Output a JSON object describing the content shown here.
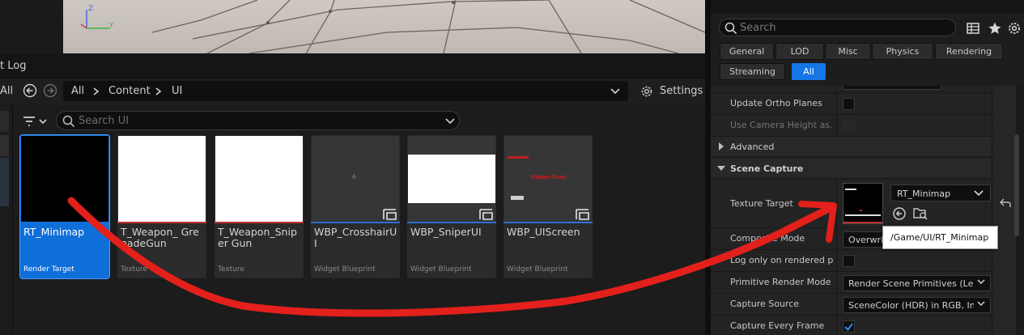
{
  "content_browser": {
    "tab_label": "t Log",
    "nav_all": "All",
    "breadcrumb": [
      "All",
      "Content",
      "UI"
    ],
    "settings_label": "Settings",
    "search_placeholder": "Search UI",
    "assets": [
      {
        "name": "RT_Minimap",
        "type": "Render Target",
        "selected": true
      },
      {
        "name": "T_Weapon_ GrenadeGun",
        "type": "Texture",
        "selected": false
      },
      {
        "name": "T_Weapon_Sniper Gun",
        "type": "Texture",
        "selected": false
      },
      {
        "name": "WBP_CrosshairUI",
        "type": "Widget Blueprint",
        "selected": false
      },
      {
        "name": "WBP_SniperUI",
        "type": "Widget Blueprint",
        "selected": false
      },
      {
        "name": "WBP_UIScreen",
        "type": "Widget Blueprint",
        "selected": false
      }
    ],
    "thumb_game_over": "Game Over",
    "thumb_crosshair": "✧"
  },
  "details": {
    "search_placeholder": "Search",
    "categories": [
      "General",
      "LOD",
      "Misc",
      "Physics",
      "Rendering",
      "Streaming",
      "All"
    ],
    "active_category": "All",
    "rows": {
      "update_ortho": "Update Ortho Planes",
      "camera_height": "Use Camera Height as...",
      "advanced": "Advanced",
      "scene_capture": "Scene Capture",
      "texture_target": "Texture Target",
      "texture_target_value": "RT_Minimap",
      "composite_mode": "Composite Mode",
      "composite_value": "Overwrite",
      "rendered_prims": "Log only on rendered pi...",
      "primitive_render_mode": "Primitive Render Mode",
      "primitive_render_value": "Render Scene Primitives (Legacy)",
      "capture_source": "Capture Source",
      "capture_source_value": "SceneColor (HDR) in RGB, Inv Opacity in A",
      "capture_every_frame": "Capture Every Frame"
    },
    "tooltip": "/Game/UI/RT_Minimap"
  },
  "viewport": {
    "axis_z": "Z",
    "axis_y": "Y"
  },
  "colors": {
    "accent": "#1576e6",
    "annotation": "#e3201b",
    "texture_strip": "#c03030",
    "blueprint_strip": "#2d6fd0"
  }
}
